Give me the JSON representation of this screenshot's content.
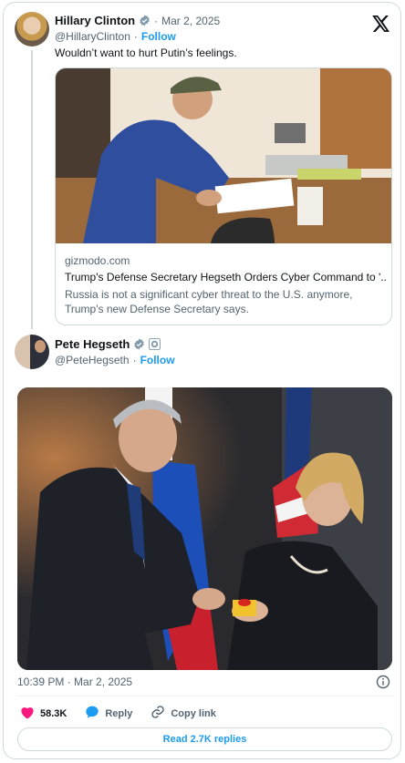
{
  "quoted_tweet": {
    "author_name": "Hillary Clinton",
    "date": "Mar 2, 2025",
    "handle": "@HillaryClinton",
    "follow_label": "Follow",
    "text": "Wouldn’t want to hurt Putin’s feelings.",
    "link_card": {
      "domain": "gizmodo.com",
      "title": "Trump's Defense Secretary Hegseth Orders Cyber Command to '...",
      "description": "Russia is not a significant cyber threat to the U.S. anymore, Trump's new Defense Secretary says."
    }
  },
  "main_tweet": {
    "author_name": "Pete Hegseth",
    "handle": "@PeteHegseth",
    "follow_label": "Follow",
    "timestamp": "10:39 PM · Mar 2, 2025"
  },
  "actions": {
    "like_count": "58.3K",
    "reply_label": "Reply",
    "copy_link_label": "Copy link"
  },
  "read_replies_label": "Read 2.7K replies",
  "colors": {
    "accent": "#1d9bf0",
    "like": "#f91880",
    "verified_gold": "#e2b719",
    "verified_gray": "#829aab",
    "text_secondary": "#536471"
  },
  "icons": [
    "x-logo-icon",
    "verified-badge-icon",
    "info-icon",
    "heart-icon",
    "reply-icon",
    "link-icon"
  ]
}
